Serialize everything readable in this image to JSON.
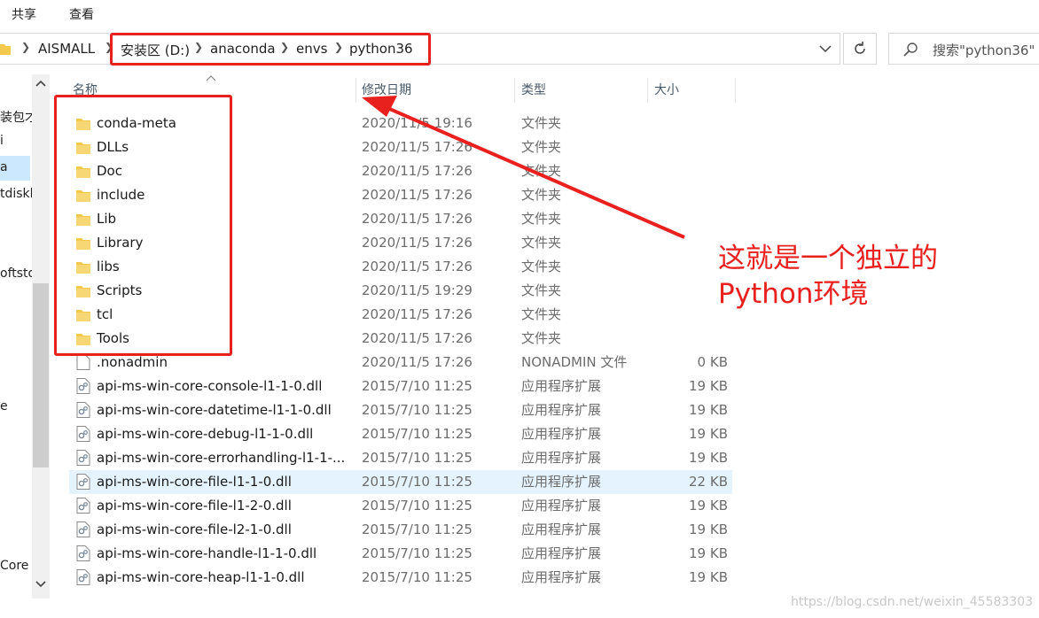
{
  "ribbon": {
    "tabs": [
      "共享",
      "查看"
    ]
  },
  "address": {
    "crumbs": [
      "AISMALL",
      "安装区 (D:)",
      "anaconda",
      "envs",
      "python36"
    ]
  },
  "search": {
    "placeholder": "搜索\"python36\""
  },
  "nav": {
    "items": [
      "装包才",
      "i",
      "a",
      "tdiskl",
      "oftsto",
      "e",
      "Core"
    ]
  },
  "columns": {
    "name": "名称",
    "date": "修改日期",
    "type": "类型",
    "size": "大小"
  },
  "files": [
    {
      "name": "conda-meta",
      "date": "2020/11/5 19:16",
      "type": "文件夹",
      "size": "",
      "kind": "folder"
    },
    {
      "name": "DLLs",
      "date": "2020/11/5 17:26",
      "type": "文件夹",
      "size": "",
      "kind": "folder"
    },
    {
      "name": "Doc",
      "date": "2020/11/5 17:26",
      "type": "文件夹",
      "size": "",
      "kind": "folder"
    },
    {
      "name": "include",
      "date": "2020/11/5 17:26",
      "type": "文件夹",
      "size": "",
      "kind": "folder"
    },
    {
      "name": "Lib",
      "date": "2020/11/5 17:26",
      "type": "文件夹",
      "size": "",
      "kind": "folder"
    },
    {
      "name": "Library",
      "date": "2020/11/5 17:26",
      "type": "文件夹",
      "size": "",
      "kind": "folder"
    },
    {
      "name": "libs",
      "date": "2020/11/5 17:26",
      "type": "文件夹",
      "size": "",
      "kind": "folder"
    },
    {
      "name": "Scripts",
      "date": "2020/11/5 19:29",
      "type": "文件夹",
      "size": "",
      "kind": "folder"
    },
    {
      "name": "tcl",
      "date": "2020/11/5 17:26",
      "type": "文件夹",
      "size": "",
      "kind": "folder"
    },
    {
      "name": "Tools",
      "date": "2020/11/5 17:26",
      "type": "文件夹",
      "size": "",
      "kind": "folder"
    },
    {
      "name": ".nonadmin",
      "date": "2020/11/5 17:26",
      "type": "NONADMIN 文件",
      "size": "0 KB",
      "kind": "file"
    },
    {
      "name": "api-ms-win-core-console-l1-1-0.dll",
      "date": "2015/7/10 11:25",
      "type": "应用程序扩展",
      "size": "19 KB",
      "kind": "dll"
    },
    {
      "name": "api-ms-win-core-datetime-l1-1-0.dll",
      "date": "2015/7/10 11:25",
      "type": "应用程序扩展",
      "size": "19 KB",
      "kind": "dll"
    },
    {
      "name": "api-ms-win-core-debug-l1-1-0.dll",
      "date": "2015/7/10 11:25",
      "type": "应用程序扩展",
      "size": "19 KB",
      "kind": "dll"
    },
    {
      "name": "api-ms-win-core-errorhandling-l1-1-...",
      "date": "2015/7/10 11:25",
      "type": "应用程序扩展",
      "size": "19 KB",
      "kind": "dll"
    },
    {
      "name": "api-ms-win-core-file-l1-1-0.dll",
      "date": "2015/7/10 11:25",
      "type": "应用程序扩展",
      "size": "22 KB",
      "kind": "dll",
      "selected": true
    },
    {
      "name": "api-ms-win-core-file-l1-2-0.dll",
      "date": "2015/7/10 11:25",
      "type": "应用程序扩展",
      "size": "19 KB",
      "kind": "dll"
    },
    {
      "name": "api-ms-win-core-file-l2-1-0.dll",
      "date": "2015/7/10 11:25",
      "type": "应用程序扩展",
      "size": "19 KB",
      "kind": "dll"
    },
    {
      "name": "api-ms-win-core-handle-l1-1-0.dll",
      "date": "2015/7/10 11:25",
      "type": "应用程序扩展",
      "size": "19 KB",
      "kind": "dll"
    },
    {
      "name": "api-ms-win-core-heap-l1-1-0.dll",
      "date": "2015/7/10 11:25",
      "type": "应用程序扩展",
      "size": "19 KB",
      "kind": "dll"
    }
  ],
  "annotation": {
    "line1": "这就是一个独立的",
    "line2": "Python环境",
    "color": "#e8201e"
  },
  "watermark": "https://blog.csdn.net/weixin_45583303",
  "colors": {
    "selection": "#e5f3ff",
    "folder": "#f2c94c",
    "accent": "#e8201e"
  }
}
